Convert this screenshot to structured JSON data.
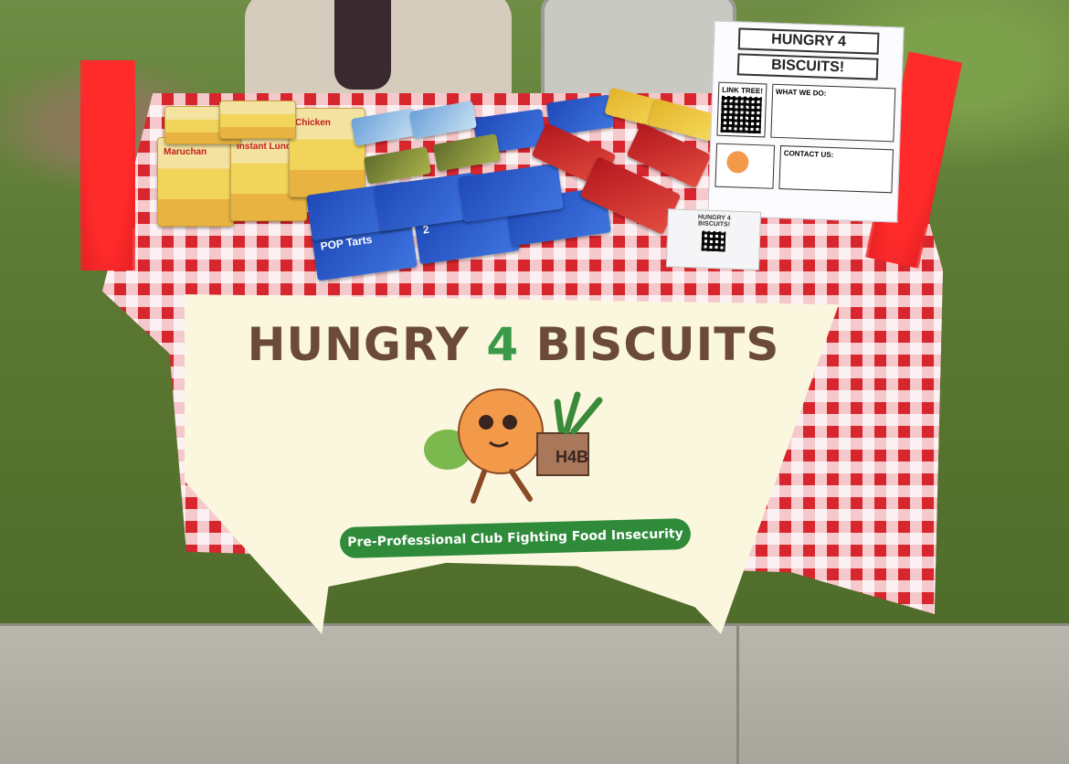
{
  "banner": {
    "title_part1": "HUNGRY",
    "title_number": "4",
    "title_part2": "BISCUITS",
    "tagline": "Pre-Professional Club Fighting Food Insecurity",
    "mascot_label": "H4B"
  },
  "flyer": {
    "title_line1": "HUNGRY 4",
    "title_line2": "BISCUITS!",
    "linktree_label": "LINK TREE!",
    "what_we_do_label": "WHAT WE DO:",
    "contact_label": "CONTACT US:"
  },
  "small_flyer": {
    "title_line1": "HUNGRY 4",
    "title_line2": "BISCUITS!"
  },
  "products": {
    "ramen_brand": "Maruchan",
    "ramen_name": "Instant Lunch",
    "ramen_flavor": "Chicken",
    "poptart_brand": "POP Tarts",
    "poptart_count": "2"
  },
  "colors": {
    "tablecloth_red": "#d8262e",
    "banner_bg": "#fbf7de",
    "title_brown": "#6b4a3a",
    "accent_green": "#3a9a4a",
    "tagline_green": "#2f8a3a"
  }
}
